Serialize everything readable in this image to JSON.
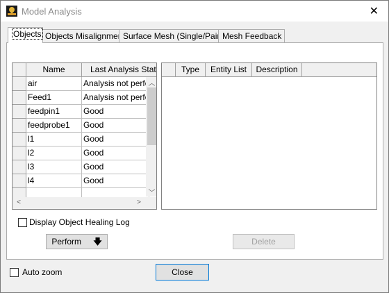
{
  "window": {
    "title": "Model Analysis",
    "close_glyph": "✕"
  },
  "tabs": [
    {
      "label": "Objects"
    },
    {
      "label": "Objects Misalignment"
    },
    {
      "label": "Surface Mesh (Single/Pairs)"
    },
    {
      "label": "Mesh Feedback"
    }
  ],
  "objects_table": {
    "columns": [
      "Name",
      "Last Analysis Status"
    ],
    "rows": [
      {
        "name": "air",
        "status": "Analysis not performed"
      },
      {
        "name": "Feed1",
        "status": "Analysis not performed"
      },
      {
        "name": "feedpin1",
        "status": "Good"
      },
      {
        "name": "feedprobe1",
        "status": "Good"
      },
      {
        "name": "l1",
        "status": "Good"
      },
      {
        "name": "l2",
        "status": "Good"
      },
      {
        "name": "l3",
        "status": "Good"
      },
      {
        "name": "l4",
        "status": "Good"
      }
    ]
  },
  "results_table": {
    "columns": [
      "Type",
      "Entity List",
      "Description"
    ]
  },
  "display_healing_log": {
    "label": "Display Object Healing Log",
    "checked": false
  },
  "perform_button": {
    "label": "Perform"
  },
  "delete_button": {
    "label": "Delete"
  },
  "auto_zoom": {
    "label": "Auto zoom",
    "checked": false
  },
  "close_button": {
    "label": "Close"
  }
}
